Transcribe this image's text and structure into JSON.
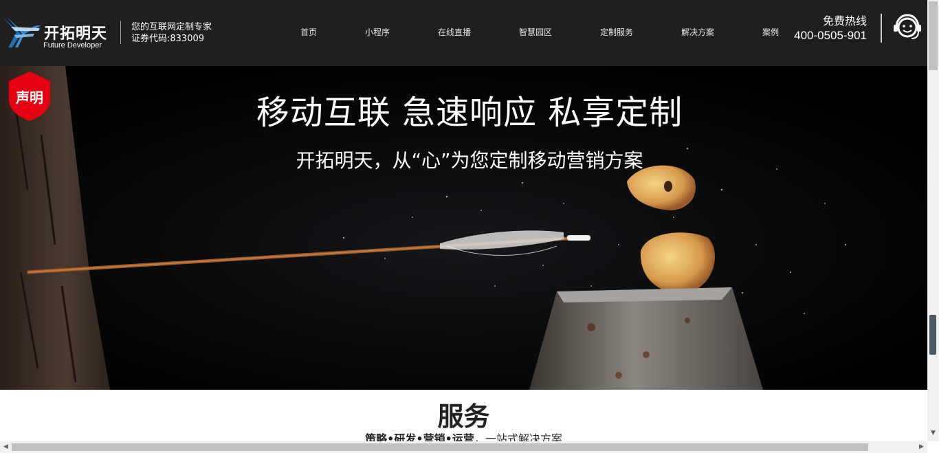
{
  "brand": {
    "name_cn": "开拓明天",
    "name_en": "Future Developer",
    "tagline_line1": "您的互联网定制专家",
    "tagline_line2": "证券代码:833009",
    "accent": "#1f6fb5"
  },
  "nav": [
    {
      "label": "首页"
    },
    {
      "label": "小程序"
    },
    {
      "label": "在线直播"
    },
    {
      "label": "智慧园区"
    },
    {
      "label": "定制服务"
    },
    {
      "label": "解决方案"
    },
    {
      "label": "案例"
    }
  ],
  "hotline": {
    "label": "免费热线",
    "number": "400-0505-901"
  },
  "badge": {
    "label": "声明",
    "color": "#e60012"
  },
  "hero": {
    "title": "移动互联 急速响应 私享定制",
    "subtitle": "开拓明天，从“心”为您定制移动营销方案"
  },
  "services": {
    "title": "服务",
    "subtitle_bold": "策略•研发•营销•运营",
    "subtitle_rest": "，一站式解决方案"
  },
  "icons": {
    "customer_service": "headset-smile-icon",
    "logo_mark": "wing-logo-icon"
  }
}
